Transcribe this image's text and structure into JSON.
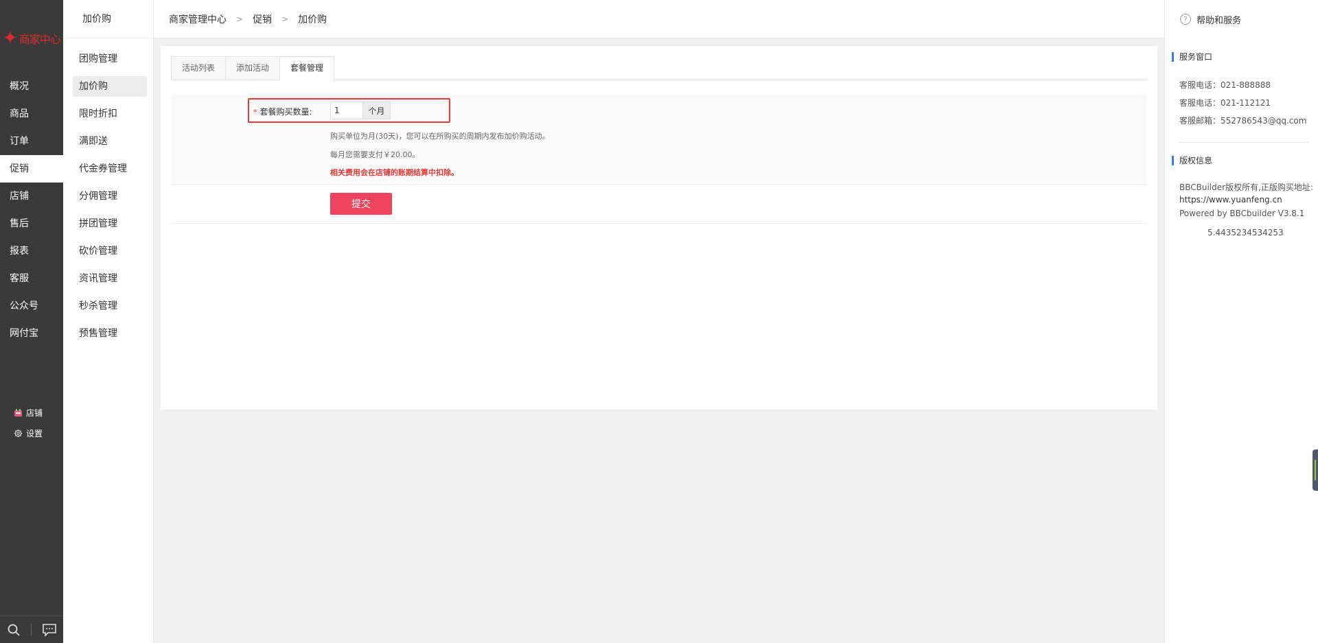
{
  "brand": {
    "logo_text": "商家中心",
    "logo_color": "#e02b2b"
  },
  "main_nav": [
    {
      "label": "概况"
    },
    {
      "label": "商品"
    },
    {
      "label": "订单"
    },
    {
      "label": "促销",
      "active": true
    },
    {
      "label": "店铺"
    },
    {
      "label": "售后"
    },
    {
      "label": "报表"
    },
    {
      "label": "客服"
    },
    {
      "label": "公众号"
    },
    {
      "label": "网付宝"
    }
  ],
  "nav_footer": {
    "shop_label": "店铺",
    "settings_label": "设置"
  },
  "sub_nav": {
    "title": "加价购",
    "items": [
      {
        "label": "团购管理"
      },
      {
        "label": "加价购",
        "active": true
      },
      {
        "label": "限时折扣"
      },
      {
        "label": "满即送"
      },
      {
        "label": "代金券管理"
      },
      {
        "label": "分佣管理"
      },
      {
        "label": "拼团管理"
      },
      {
        "label": "砍价管理"
      },
      {
        "label": "资讯管理"
      },
      {
        "label": "秒杀管理"
      },
      {
        "label": "预售管理"
      }
    ]
  },
  "breadcrumb": [
    "商家管理中心",
    "促销",
    "加价购"
  ],
  "tabs": [
    {
      "label": "活动列表"
    },
    {
      "label": "添加活动"
    },
    {
      "label": "套餐管理",
      "active": true
    }
  ],
  "form": {
    "qty_label": "套餐购买数量:",
    "required_mark": "*",
    "qty_value": "1",
    "qty_unit": "个月",
    "hint1": "购买单位为月(30天)，您可以在所购买的周期内发布加价购活动。",
    "hint2": "每月您需要支付￥20.00。",
    "hint3": "相关费用会在店铺的账期结算中扣除。",
    "submit_label": "提交"
  },
  "help": {
    "title": "帮助和服务",
    "service_title": "服务窗口",
    "service_lines": [
      "客服电话：021-888888",
      "客服电话：021-112121",
      "客服邮箱：552786543@qq.com"
    ],
    "copyright_title": "版权信息",
    "copyright_lines": [
      "BBCBuilder版权所有,正版购买地址:",
      "https://www.yuanfeng.cn",
      "Powered by BBCbuilder V3.8.1"
    ],
    "version_number": "5.4435234534253"
  },
  "colors": {
    "accent": "#f0435d",
    "highlight": "#e53935",
    "nav_bg": "#3a3a3a"
  }
}
